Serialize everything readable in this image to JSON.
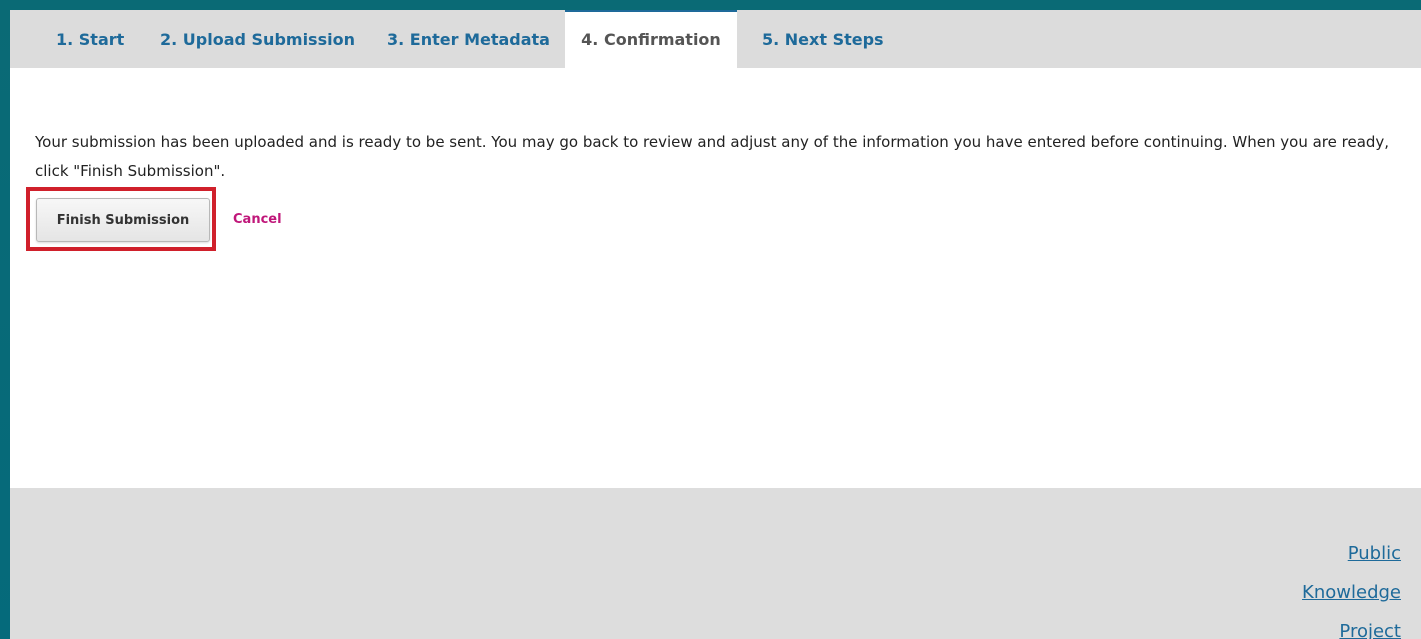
{
  "tabs": [
    {
      "label": "1. Start"
    },
    {
      "label": "2. Upload Submission"
    },
    {
      "label": "3. Enter Metadata"
    },
    {
      "label": "4. Confirmation"
    },
    {
      "label": "5. Next Steps"
    }
  ],
  "main": {
    "message": "Your submission has been uploaded and is ready to be sent. You may go back to review and adjust any of the information you have entered before continuing. When you are ready, click \"Finish Submission\".",
    "finish_label": "Finish Submission",
    "cancel_label": "Cancel"
  },
  "footer": {
    "links": [
      "Public",
      "Knowledge",
      "Project"
    ]
  },
  "colors": {
    "link": "#1e6a9a",
    "cancel": "#c0177a",
    "highlight": "#d0202b",
    "background": "#056a7b"
  }
}
